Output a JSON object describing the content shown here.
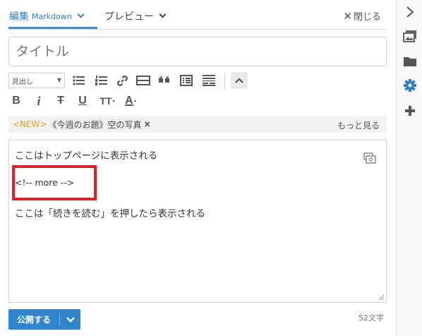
{
  "tabs": {
    "edit": {
      "label": "編集",
      "sublabel": "Markdown"
    },
    "preview": {
      "label": "プレビュー"
    },
    "close": {
      "icon": "close-icon",
      "label": "閉じる"
    }
  },
  "rail": {
    "icons": [
      "chevron-right-icon",
      "images-icon",
      "folder-icon",
      "gear-icon",
      "plus-icon"
    ],
    "accent": "#2e7ec0"
  },
  "title": {
    "placeholder": "タイトル",
    "value": ""
  },
  "toolbar": {
    "heading_select": "見出し",
    "icons": [
      "bullet-list-icon",
      "numbered-list-icon",
      "link-icon",
      "horizontal-rule-icon",
      "quote-icon",
      "table-icon",
      "more-text-icon",
      "collapse-icon"
    ],
    "format": {
      "bold": "B",
      "italic": "i",
      "strike": "T",
      "underline": "U",
      "size": "TT",
      "color": "A"
    }
  },
  "image_bar": {
    "new_tag": "<NEW>",
    "item": "《今週のお題》空の写真",
    "remove": "×",
    "more": "もっと見る"
  },
  "editor": {
    "lines": [
      "ここはトップページに表示される",
      "<!-- more -->",
      "ここは「続きを読む」を押したら表示される"
    ],
    "highlight_color": "#d4232a"
  },
  "footer": {
    "publish": "公開する",
    "char_count": "52文字"
  },
  "colors": {
    "brand": "#2f86cc",
    "new_tag": "#e8a21a"
  }
}
